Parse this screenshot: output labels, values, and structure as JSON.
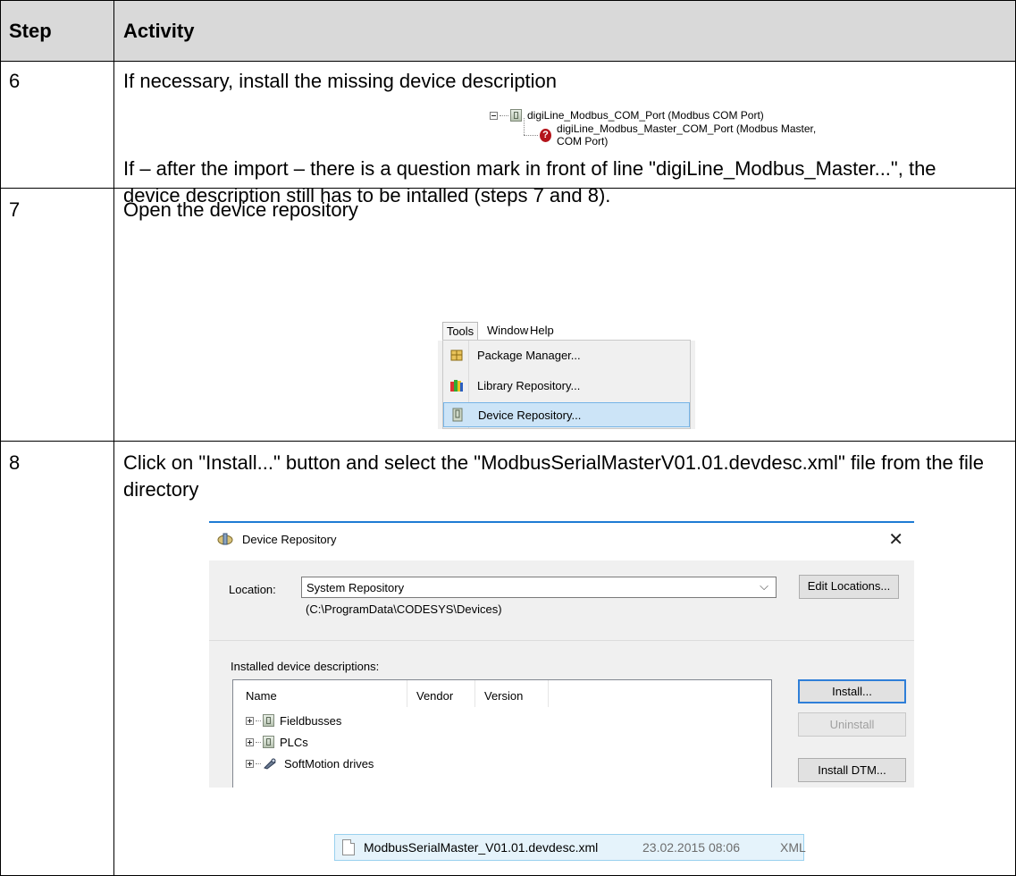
{
  "table": {
    "col_step": "Step",
    "col_activity": "Activity"
  },
  "rows": [
    {
      "step": "6",
      "title": "If necessary, install the missing device description",
      "note": "If – after the import – there is a question mark in front of line \"digiLine_Modbus_Master...\", the device description still has to be intalled (steps 7 and 8).",
      "tree": {
        "parent": "digiLine_Modbus_COM_Port (Modbus COM Port)",
        "child": "digiLine_Modbus_Master_COM_Port (Modbus Master, COM Port)"
      }
    },
    {
      "step": "7",
      "title": "Open the device repository",
      "menu": {
        "bar": [
          "Tools",
          "Window",
          "Help"
        ],
        "items": [
          "Package Manager...",
          "Library Repository...",
          "Device Repository..."
        ]
      }
    },
    {
      "step": "8",
      "title": "Click on \"Install...\" button and select the \"ModbusSerialMasterV01.01.devdesc.xml\" file from the file directory",
      "dialog": {
        "title": "Device Repository",
        "location_label": "Location:",
        "location_value": "System Repository",
        "location_path": "(C:\\ProgramData\\CODESYS\\Devices)",
        "edit_locations": "Edit Locations...",
        "installed_label": "Installed device descriptions:",
        "columns": [
          "Name",
          "Vendor",
          "Version"
        ],
        "items": [
          "Fieldbusses",
          "PLCs",
          "SoftMotion drives"
        ],
        "install": "Install...",
        "uninstall": "Uninstall",
        "install_dtm": "Install DTM..."
      },
      "file": {
        "name": "ModbusSerialMaster_V01.01.devdesc.xml",
        "date": "23.02.2015 08:06",
        "type": "XML"
      }
    }
  ]
}
